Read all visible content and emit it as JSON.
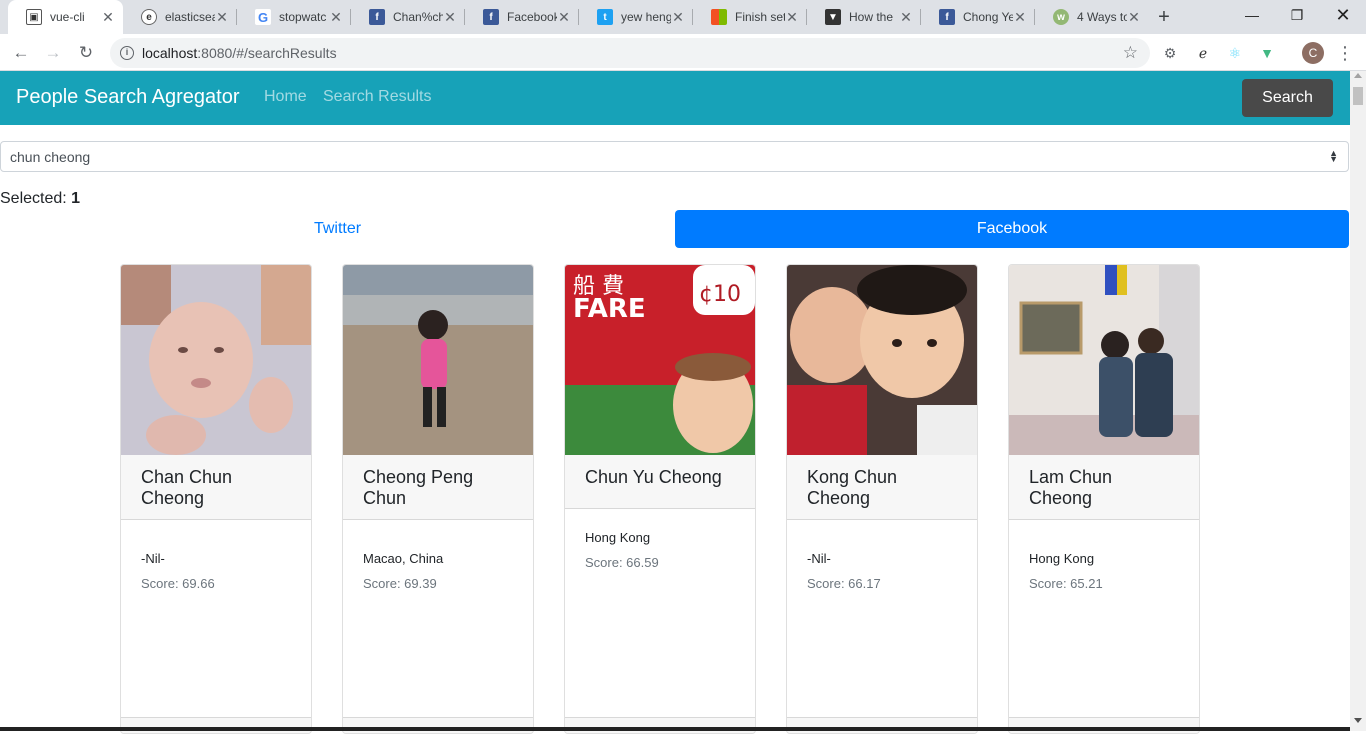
{
  "browser": {
    "tabs": [
      {
        "title": "vue-cli",
        "icon": "vue-icon",
        "active": true
      },
      {
        "title": "elasticsea",
        "icon": "elastic-icon"
      },
      {
        "title": "stopwatc",
        "icon": "google-icon"
      },
      {
        "title": "Chan%ch",
        "icon": "facebook-icon"
      },
      {
        "title": "Facebook",
        "icon": "facebook-icon"
      },
      {
        "title": "yew heng",
        "icon": "twitter-icon"
      },
      {
        "title": "Finish set",
        "icon": "microsoft-icon"
      },
      {
        "title": "How the",
        "icon": "bookmark-icon"
      },
      {
        "title": "Chong Ye",
        "icon": "facebook-icon"
      },
      {
        "title": "4 Ways to",
        "icon": "wikihow-icon"
      }
    ],
    "url_host": "localhost",
    "url_path": ":8080/#/searchResults",
    "profile_initial": "C"
  },
  "app": {
    "brand": "People Search Agregator",
    "nav": {
      "home": "Home",
      "results": "Search Results"
    },
    "search_button": "Search",
    "query": "chun cheong",
    "selected_label": "Selected: ",
    "selected_value": "1",
    "tabs": {
      "twitter": "Twitter",
      "facebook": "Facebook"
    },
    "accent": "#17a2b8",
    "primary": "#007bff"
  },
  "results": [
    {
      "name": "Chan Chun Cheong",
      "location": "-Nil-",
      "score": "Score: 69.66"
    },
    {
      "name": "Cheong Peng Chun",
      "location": "Macao, China",
      "score": "Score: 69.39"
    },
    {
      "name": "Chun Yu Cheong",
      "location": "Hong Kong",
      "score": "Score: 66.59",
      "photo_text": [
        "船 費",
        "FARE",
        "¢10"
      ]
    },
    {
      "name": "Kong Chun Cheong",
      "location": "-Nil-",
      "score": "Score: 66.17"
    },
    {
      "name": "Lam Chun Cheong",
      "location": "Hong Kong",
      "score": "Score: 65.21"
    }
  ]
}
